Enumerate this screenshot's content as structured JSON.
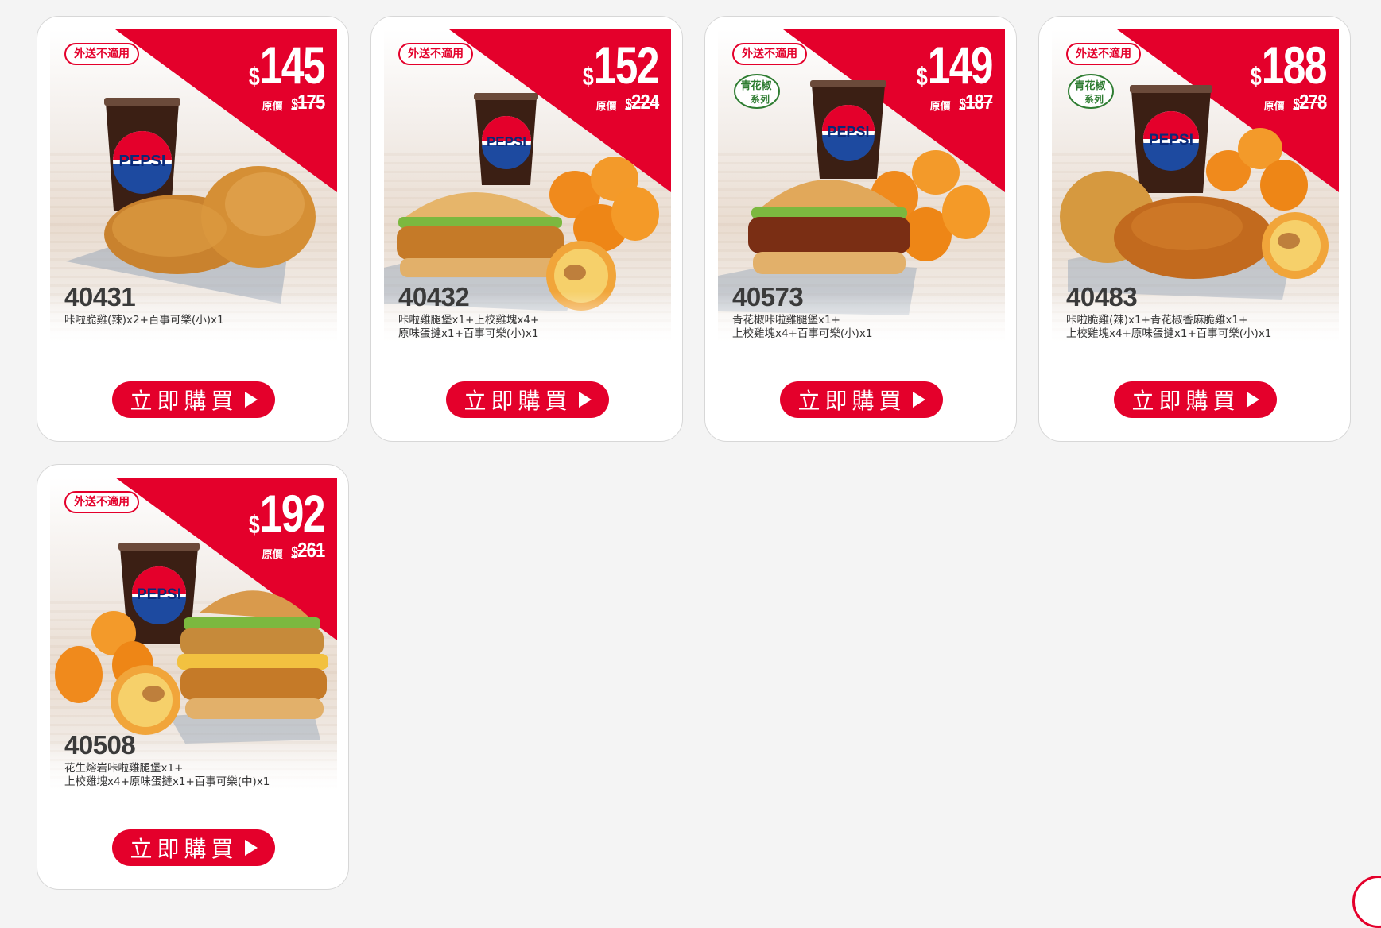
{
  "colors": {
    "brand_red": "#e4002b",
    "page_bg": "#f4f4f4",
    "green_badge": "#2f7d32"
  },
  "cards": [
    {
      "no_delivery": "外送不適用",
      "price_currency": "$",
      "price": "145",
      "orig_label": "原價",
      "orig_currency": "$",
      "orig_price": "175",
      "code": "40431",
      "desc": "咔啦脆雞(辣)x2+百事可樂(小)x1",
      "buy_label": "立即購買",
      "green_badge": false,
      "items": [
        "pepsi-cup",
        "fried-chicken"
      ]
    },
    {
      "no_delivery": "外送不適用",
      "price_currency": "$",
      "price": "152",
      "orig_label": "原價",
      "orig_currency": "$",
      "orig_price": "224",
      "code": "40432",
      "desc": "咔啦雞腿堡x1+上校雞塊x4+\n原味蛋撻x1+百事可樂(小)x1",
      "buy_label": "立即購買",
      "green_badge": false,
      "items": [
        "pepsi-cup",
        "burger",
        "nuggets",
        "egg-tart"
      ]
    },
    {
      "no_delivery": "外送不適用",
      "price_currency": "$",
      "price": "149",
      "orig_label": "原價",
      "orig_currency": "$",
      "orig_price": "187",
      "code": "40573",
      "desc": "青花椒咔啦雞腿堡x1+\n上校雞塊x4+百事可樂(小)x1",
      "buy_label": "立即購買",
      "green_badge": true,
      "green_badge_text": [
        "青花椒",
        "系列"
      ],
      "items": [
        "pepsi-cup",
        "burger",
        "nuggets"
      ]
    },
    {
      "no_delivery": "外送不適用",
      "price_currency": "$",
      "price": "188",
      "orig_label": "原價",
      "orig_currency": "$",
      "orig_price": "278",
      "code": "40483",
      "desc": "咔啦脆雞(辣)x1+青花椒香麻脆雞x1+\n上校雞塊x4+原味蛋撻x1+百事可樂(小)x1",
      "buy_label": "立即購買",
      "green_badge": true,
      "green_badge_text": [
        "青花椒",
        "系列"
      ],
      "items": [
        "pepsi-cup",
        "fried-chicken",
        "nuggets",
        "egg-tart"
      ]
    },
    {
      "no_delivery": "外送不適用",
      "price_currency": "$",
      "price": "192",
      "orig_label": "原價",
      "orig_currency": "$",
      "orig_price": "261",
      "code": "40508",
      "desc": "花生熔岩咔啦雞腿堡x1+\n上校雞塊x4+原味蛋撻x1+百事可樂(中)x1",
      "buy_label": "立即購買",
      "green_badge": false,
      "items": [
        "pepsi-cup",
        "burger",
        "nuggets",
        "egg-tart"
      ]
    }
  ]
}
